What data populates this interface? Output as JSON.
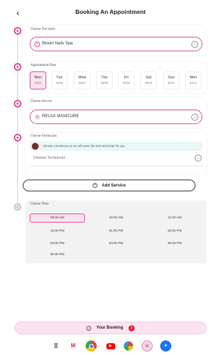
{
  "header": {
    "back_icon": "chevron-left-icon",
    "back_glyph": "‹",
    "title": "Booking An Appointment"
  },
  "store": {
    "label": "Choose The Store",
    "value": "Bloom Nails Spa",
    "store_glyph": "b",
    "chevron": "⌄"
  },
  "date": {
    "label": "Appointment Date",
    "days": [
      {
        "name": "Mon",
        "date": "08/05",
        "selected": true
      },
      {
        "name": "Tue",
        "date": "08/06",
        "selected": false
      },
      {
        "name": "Wed",
        "date": "08/07",
        "selected": false
      },
      {
        "name": "Thu",
        "date": "08/08",
        "selected": false
      },
      {
        "name": "Fri",
        "date": "08/09",
        "selected": false
      },
      {
        "name": "Sat",
        "date": "08/10",
        "selected": false
      },
      {
        "name": "Sun",
        "date": "08/11",
        "selected": false
      },
      {
        "name": "Mon",
        "date": "08/12",
        "selected": false
      }
    ]
  },
  "service": {
    "label": "Choose Service",
    "value": "RELAX MANICURE",
    "chevron": "⌄"
  },
  "technician": {
    "label": "Choose Technician",
    "note": "Choose a technician or we will select the best technician for you.",
    "placeholder": "Choose Technician",
    "chevron": "⌄"
  },
  "add_service": {
    "icon": "plus-circle-icon",
    "glyph": "+",
    "label": "Add Service"
  },
  "time": {
    "label": "Choose Time",
    "slots": [
      {
        "label": "09:00 AM",
        "selected": true
      },
      {
        "label": "10:00 AM",
        "selected": false
      },
      {
        "label": "11:00 AM",
        "selected": false
      },
      {
        "label": "12:00 PM",
        "selected": false
      },
      {
        "label": "01:00 PM",
        "selected": false
      },
      {
        "label": "02:00 PM",
        "selected": false
      },
      {
        "label": "03:00 PM",
        "selected": false
      },
      {
        "label": "04:00 PM",
        "selected": false
      },
      {
        "label": "05:00 PM",
        "selected": false
      },
      {
        "label": "06:00 PM",
        "selected": false
      }
    ]
  },
  "booking": {
    "check_glyph": "✓",
    "label": "Your Booking",
    "count": "1"
  },
  "dock": {
    "apps": [
      "app-grid-icon",
      "gmail-icon",
      "chrome-icon",
      "youtube-icon",
      "photos-icon",
      "bloom-nails-app-icon",
      "messages-icon"
    ],
    "grid_glyph": "⠿",
    "gmail_glyph": "M",
    "youtube_glyph": "▶",
    "nails_glyph": "N",
    "messages_glyph": "●"
  },
  "colors": {
    "accent": "#d64b95",
    "accent_light": "#fbe4ef",
    "note_bg": "#e9f7f7",
    "badge": "#e0243d"
  }
}
